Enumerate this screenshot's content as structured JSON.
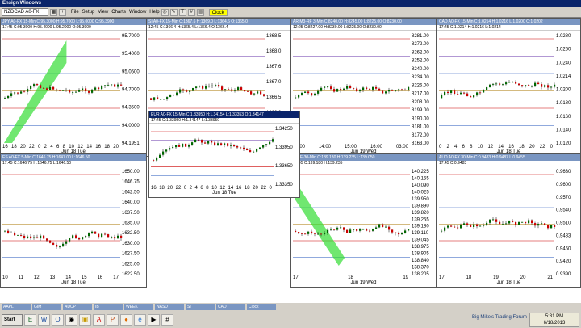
{
  "app": {
    "title": "Ensign Windows",
    "symbol": "NZDCAD A0-FX"
  },
  "menu": [
    "File",
    "Setup",
    "View",
    "Charts",
    "Window",
    "Help"
  ],
  "clock_button": "Clock",
  "windows": [
    {
      "title": "JPY A0-FX 15-Min C:95.3000 H:95.7000 L:95.0000 O:95.3900",
      "info": "17:45  C:95.3000  H:95.4000  L:95.2000  O:95.3900",
      "axis": [
        "95.7000",
        "95.4000",
        "95.0500",
        "94.7000",
        "94.3500",
        "94.0000",
        "94.1951"
      ],
      "xticks": [
        "16",
        "18",
        "20",
        "22",
        "0",
        "2",
        "4",
        "6",
        "8",
        "10",
        "12",
        "14",
        "16",
        "18",
        "20"
      ],
      "date": "Jun 18 Tue"
    },
    {
      "title": "SI A0-FX 15-Min C:1367.6 H:1369.0 L:1364.6 O:1365.0",
      "info": "12:45  C:1366.4  H:1365.4  L:1366.4  O:1366.4",
      "axis": [
        "1368.5",
        "1368.0",
        "1367.6",
        "1367.0",
        "1366.5",
        "1366.0",
        "1365.5",
        "1365.0"
      ],
      "xticks": [
        "18",
        "20",
        "22",
        "0",
        "2",
        "4",
        "6",
        "8",
        "10",
        "12",
        "14",
        "16",
        "18"
      ],
      "date": "Jun 18 Tue"
    },
    {
      "title": "AR M3-RF 3-Min C:8240.00 H:8245.00 L:8225.00 O:8230.00",
      "info": "12:25  C:8227.00  H:8230.00  L:8225.00  O:8230.00",
      "axis": [
        "8281.00",
        "8272.00",
        "8262.00",
        "8252.00",
        "8240.00",
        "8234.00",
        "8226.00",
        "8217.00",
        "8208.00",
        "8199.00",
        "8190.00",
        "8181.00",
        "8172.00",
        "8163.00"
      ],
      "xticks": [
        "13:00",
        "14:00",
        "15:00",
        "16:00",
        "03:00"
      ],
      "date": "Jun 19 Wed"
    },
    {
      "title": "CAD A0-FX 15-Min C:1.0214 H:1.0216 L:1.0200 O:1.0202",
      "info": "17:45  C:1.0214  H:1.0216  L:1.0214",
      "axis": [
        "1.0280",
        "1.0260",
        "1.0240",
        "1.0214",
        "1.0200",
        "1.0180",
        "1.0160",
        "1.0140",
        "1.0120"
      ],
      "xticks": [
        "0",
        "2",
        "4",
        "6",
        "8",
        "10",
        "12",
        "14",
        "16",
        "18",
        "20",
        "22",
        "0"
      ],
      "date": "Jun 18 Tue"
    },
    {
      "title": "EUR A0-FX 15-Min C:1.33950 H:1.34154 L:1.33353 O:1.34147",
      "info": "17:45  C:1.33950  H:1.34147  L:1.33950",
      "axis": [
        "1.34250",
        "1.33950",
        "1.33650",
        "1.33350"
      ],
      "xticks": [
        "16",
        "18",
        "20",
        "22",
        "0",
        "2",
        "4",
        "6",
        "8",
        "10",
        "12",
        "14",
        "16",
        "18",
        "20",
        "22",
        "0"
      ],
      "date": "Jun 18 Tue"
    },
    {
      "title": "ES A0-FX 5-Min C:1646.75 H:1647.00 L:1646.50",
      "info": "17:45  C:1646.75  H:1646.75  L:1646.50",
      "axis": [
        "1650.00",
        "1646.75",
        "1642.50",
        "1640.00",
        "1637.50",
        "1635.00",
        "1632.50",
        "1630.00",
        "1627.50",
        "1625.00",
        "1622.50"
      ],
      "xticks": [
        "10",
        "11",
        "12",
        "13",
        "14",
        "15",
        "16",
        "17"
      ],
      "date": "Jun 18 Tue"
    },
    {
      "title": "AI 3F-30-Min C:139.180 H:139.235 L:139.050",
      "info": "17:45  C:139.180  H:139.235",
      "axis": [
        "140.225",
        "140.155",
        "140.090",
        "140.025",
        "139.950",
        "139.890",
        "139.820",
        "139.255",
        "139.180",
        "139.110",
        "139.045",
        "138.975",
        "138.905",
        "138.840",
        "138.370",
        "138.205"
      ],
      "xticks": [
        "17",
        "18",
        "19"
      ],
      "date": "Jun 19 Wed"
    },
    {
      "title": "AUD A0-FX 30-Min C:0.9483 H:0.9487 L:0.9455",
      "info": "17:45  C:0.9483",
      "axis": [
        "0.9630",
        "0.9600",
        "0.9570",
        "0.9540",
        "0.9510",
        "0.9483",
        "0.9450",
        "0.9420",
        "0.9390"
      ],
      "xticks": [
        "17",
        "18",
        "19",
        "20",
        "21"
      ],
      "date": "Jun 18 Tue"
    }
  ],
  "mini_tabs": [
    "AAPL",
    "GIM",
    "AUCP",
    "IB",
    "WEEK",
    "NASD",
    "SI",
    "CAD",
    "Clock"
  ],
  "taskbar": {
    "start": "Start",
    "time": "5:31 PM",
    "date": "6/18/2013"
  },
  "branding": "Big Mike's Trading Forum",
  "colors": {
    "bull": "#006600",
    "bear": "#cc0000",
    "band": "#33dd33"
  }
}
